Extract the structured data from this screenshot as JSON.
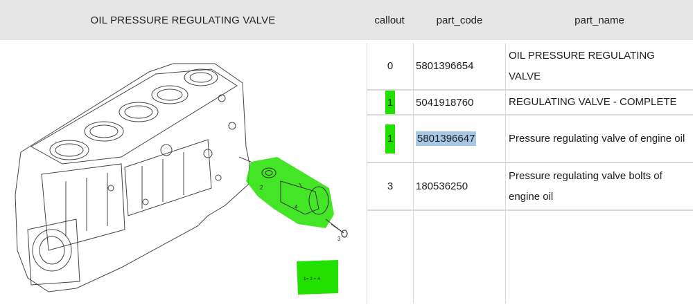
{
  "header": {
    "title": "OIL PRESSURE REGULATING VALVE",
    "col_callout": "callout",
    "col_code": "part_code",
    "col_name": "part_name"
  },
  "rows": [
    {
      "callout": "0",
      "part_code": "5801396654",
      "part_name": "OIL PRESSURE REGULATING VALVE"
    },
    {
      "callout": "1",
      "part_code": "5041918760",
      "part_name": "REGULATING VALVE - COMPLETE"
    },
    {
      "callout": "1",
      "part_code": "5801396647",
      "part_name": "Pressure regulating valve of engine oil"
    },
    {
      "callout": "3",
      "part_code": "180536250",
      "part_name": "Pressure regulating valve bolts of engine oil"
    }
  ],
  "diagram": {
    "callouts": [
      "2",
      "4",
      "3"
    ],
    "legend": "1= 2 + 4"
  },
  "colors": {
    "highlight_green": "#22e000",
    "selection_blue": "#a7c7e7",
    "header_bg": "#e6e6e6"
  }
}
